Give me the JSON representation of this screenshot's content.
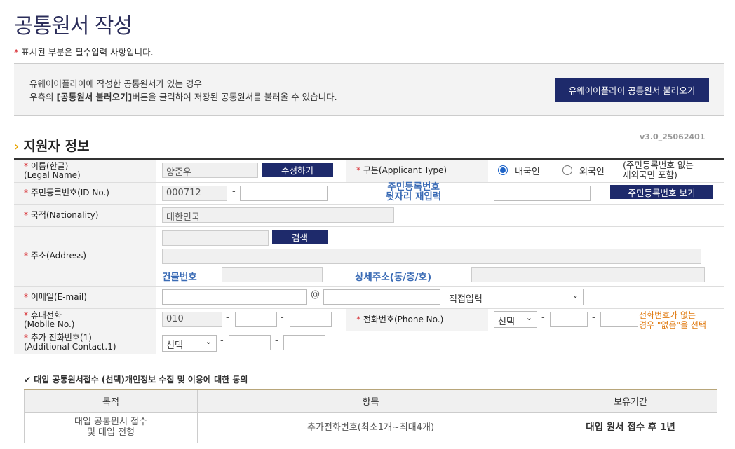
{
  "page_title": "공통원서 작성",
  "required_note": {
    "star": "*",
    "text": "표시된 부분은 필수입력 사항입니다."
  },
  "info_box": {
    "line1": "유웨이어플라이에 작성한 공통원서가 있는 경우",
    "line2_pre": "우측의 ",
    "line2_bold": "[공통원서 불러오기]",
    "line2_post": "버튼을 클릭하여 저장된 공통원서를 불러올 수 있습니다.",
    "load_button": "유웨이어플라이 공통원서 불러오기"
  },
  "section_title": "지원자 정보",
  "section_chevron": "›",
  "version": "v3.0_25062401",
  "form": {
    "name": {
      "label_ko": "이름(한글)",
      "label_en": "(Legal Name)",
      "value": "양준우",
      "edit_button": "수정하기"
    },
    "type": {
      "label": "구분(Applicant Type)",
      "option_domestic": "내국인",
      "option_foreign": "외국인",
      "note_line1": "(주민등록번호 없는",
      "note_line2": "재외국민 포함)",
      "selected": "내국인"
    },
    "id": {
      "label": "주민등록번호(ID No.)",
      "front": "000712",
      "back": "",
      "reenter_line1": "주민등록번호",
      "reenter_line2": "뒷자리 재입력",
      "show_button": "주민등록번호 보기"
    },
    "nationality": {
      "label": "국적(Nationality)",
      "value": "대한민국"
    },
    "address": {
      "label": "주소(Address)",
      "search_button": "검색",
      "building_label": "건물번호",
      "detail_label": "상세주소(동/층/호)"
    },
    "email": {
      "label": "이메일(E-mail)",
      "at": "@",
      "domain_select": "직접입력"
    },
    "mobile": {
      "label_ko": "휴대전화",
      "label_en": "(Mobile No.)",
      "part1": "010"
    },
    "phone": {
      "label": "전화번호(Phone No.)",
      "select": "선택",
      "note_line1": "전화번호가 없는",
      "note_line2": "경우 \"없음\"을 선택"
    },
    "additional": {
      "label_ko": "추가 전화번호(1)",
      "label_en": "(Additional Contact.1)",
      "select": "선택"
    },
    "star": "*",
    "dash": "-"
  },
  "consent": {
    "check": "✔",
    "title": "대입 공통원서접수 (선택)개인정보 수집 및 이용에 대한 동의",
    "headers": [
      "목적",
      "항목",
      "보유기간"
    ],
    "purpose_line1": "대입 공통원서 접수",
    "purpose_line2": "및 대입 전형",
    "item": "추가전화번호(최소1개~최대4개)",
    "period": "대입 원서 접수 후 1년"
  }
}
